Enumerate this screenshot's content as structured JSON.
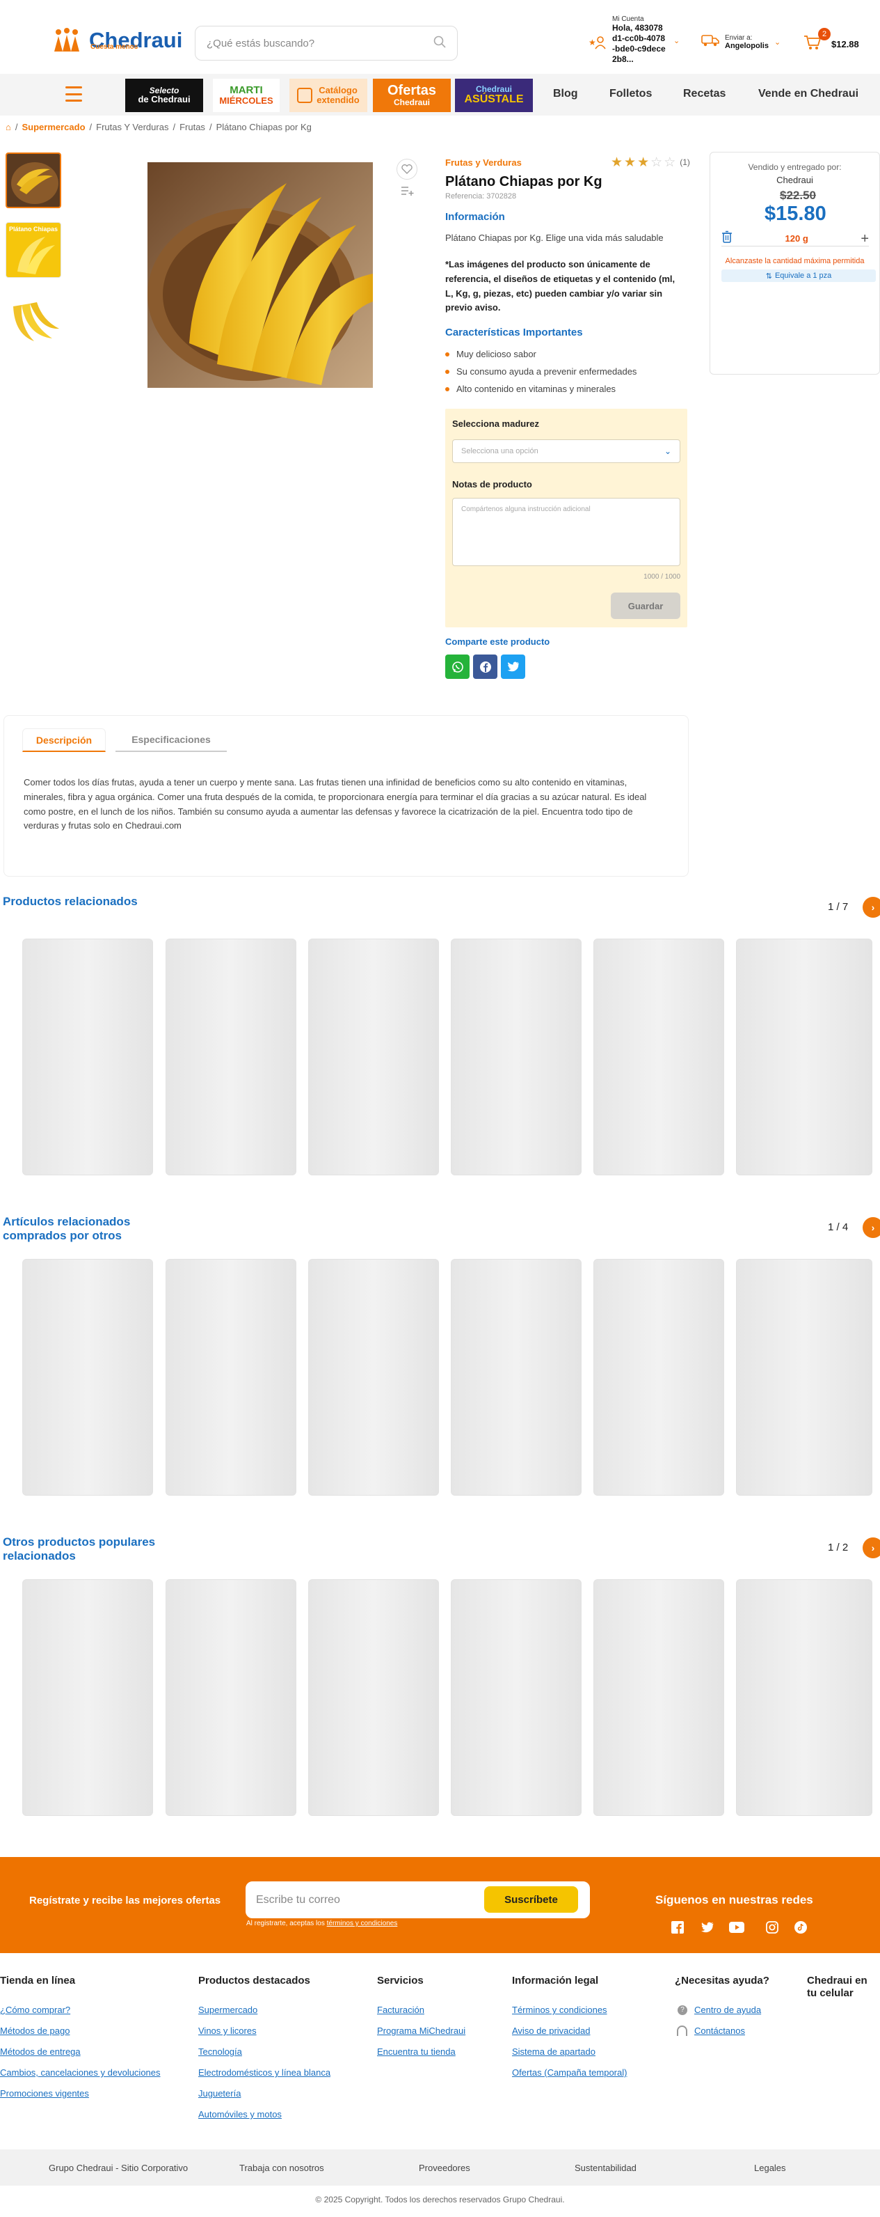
{
  "header": {
    "logo_text": "Chedraui",
    "logo_tagline": "Cuesta menos",
    "search_placeholder": "¿Qué estás buscando?",
    "account_label": "Mi Cuenta",
    "account_name": "Hola, 483078d1-cc0b-4078-bde0-c9dece2b8...",
    "ship_label": "Enviar a:",
    "ship_location": "Angelopolis",
    "cart_count": "2",
    "cart_total": "$12.88"
  },
  "nav": {
    "promos": [
      {
        "line1": "Selecto",
        "line2": "de Chedraui"
      },
      {
        "line1": "MARTI",
        "line2": "MIÉRCOLES"
      },
      {
        "line1": "Catálogo",
        "line2": "extendido"
      },
      {
        "line1": "Ofertas",
        "line2": "Chedraui"
      },
      {
        "line1": "Chedraui",
        "line2": "ASÚSTALE"
      }
    ],
    "links": [
      "Blog",
      "Folletos",
      "Recetas",
      "Vende en Chedraui"
    ]
  },
  "breadcrumb": [
    "Supermercado",
    "Frutas Y Verduras",
    "Frutas",
    "Plátano Chiapas por Kg"
  ],
  "gallery": {
    "thumb_banner": "Plátano Chiapas"
  },
  "product": {
    "category": "Frutas y Verduras",
    "title": "Plátano Chiapas por Kg",
    "reference": "Referencia: 3702828",
    "rating": 3,
    "rating_max": 5,
    "rating_count": "(1)",
    "info_heading": "Información",
    "info_text": "Plátano Chiapas por Kg. Elige una vida más saludable",
    "disclaimer": "*Las imágenes del producto son únicamente de referencia, el diseños de etiquetas y el contenido (ml, L, Kg, g, piezas, etc) pueden cambiar y/o variar sin previo aviso.",
    "features_heading": "Características Importantes",
    "features": [
      "Muy delicioso sabor",
      "Su consumo ayuda a prevenir enfermedades",
      "Alto contenido en vitaminas y minerales"
    ]
  },
  "options": {
    "ripeness_label": "Selecciona madurez",
    "ripeness_placeholder": "Selecciona una opción",
    "notes_label": "Notas de producto",
    "notes_placeholder": "Compártenos alguna instrucción adicional",
    "char_count": "1000 / 1000",
    "save_label": "Guardar"
  },
  "share": {
    "label": "Comparte este producto"
  },
  "seller": {
    "sold_by": "Vendido y entregado por:",
    "seller_name": "Chedraui",
    "old_price": "$22.50",
    "price": "$15.80",
    "quantity": "120 g",
    "warning": "Alcanzaste la cantidad máxima permitida",
    "equivalent": "Equivale a 1 pza"
  },
  "tabs": {
    "description_tab": "Descripción",
    "specs_tab": "Especificaciones",
    "description": "Comer todos los días frutas, ayuda a tener un cuerpo y mente sana. Las frutas tienen una infinidad de beneficios como su alto contenido en vitaminas, minerales, fibra y agua orgánica. Comer una fruta después de la comida, te proporcionara energía para terminar el día gracias a su azúcar natural. Es ideal como postre, en el lunch de los niños. También su consumo ayuda a aumentar las defensas y favorece la cicatrización de la piel. Encuentra todo tipo de verduras y frutas solo en Chedraui.com"
  },
  "carousels": [
    {
      "title": "Productos relacionados",
      "page": "1 / 7"
    },
    {
      "title": "Artículos relacionados comprados por otros",
      "page": "1 / 4"
    },
    {
      "title": "Otros productos populares relacionados",
      "page": "1 / 2"
    }
  ],
  "newsletter": {
    "prompt": "Regístrate y recibe las mejores ofertas",
    "email_placeholder": "Escribe tu correo",
    "subscribe_label": "Suscríbete",
    "legal_prefix": "Al registrarte, aceptas los ",
    "legal_link": "términos y condiciones",
    "social_heading": "Síguenos en nuestras redes"
  },
  "footer": {
    "columns": [
      {
        "title": "Tienda en línea",
        "links": [
          "¿Cómo comprar?",
          "Métodos de pago",
          "Métodos de entrega",
          "Cambios, cancelaciones y devoluciones",
          "Promociones vigentes"
        ]
      },
      {
        "title": "Productos destacados",
        "links": [
          "Supermercado",
          "Vinos y licores",
          "Tecnología",
          "Electrodomésticos y línea blanca",
          "Juguetería",
          "Automóviles y motos"
        ]
      },
      {
        "title": "Servicios",
        "links": [
          "Facturación",
          "Programa MiChedraui",
          "Encuentra tu tienda"
        ]
      },
      {
        "title": "Información legal",
        "links": [
          "Términos y condiciones",
          "Aviso de privacidad",
          "Sistema de apartado",
          "Ofertas (Campaña temporal)"
        ]
      },
      {
        "title": "¿Necesitas ayuda?",
        "links": [
          "Centro de ayuda",
          "Contáctanos"
        ]
      },
      {
        "title": "Chedraui en tu celular",
        "links": []
      }
    ],
    "bottom_links": [
      "Grupo Chedraui - Sitio Corporativo",
      "Trabaja con nosotros",
      "Proveedores",
      "Sustentabilidad",
      "Legales"
    ],
    "copyright": "© 2025 Copyright. Todos los derechos reservados Grupo Chedraui."
  },
  "colors": {
    "brand_orange": "#f0780a",
    "brand_blue": "#1a6fc0",
    "whatsapp": "#25d366",
    "facebook": "#3b5998",
    "twitter": "#1da1f2"
  }
}
